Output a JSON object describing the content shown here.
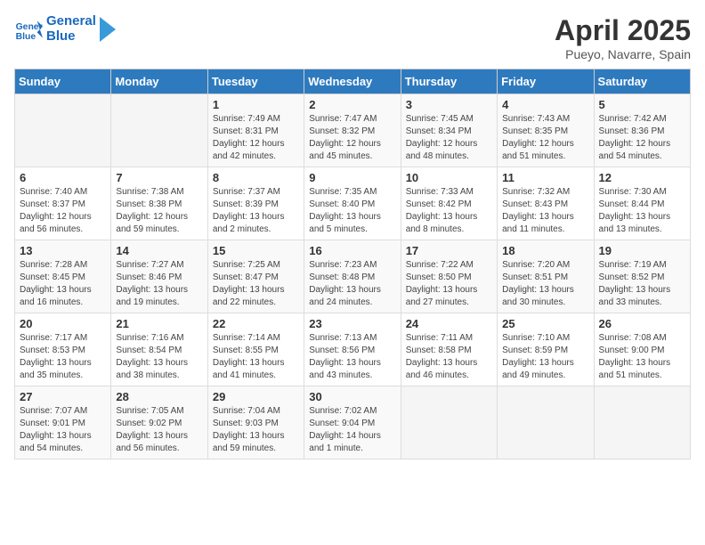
{
  "header": {
    "logo_line1": "General",
    "logo_line2": "Blue",
    "month_title": "April 2025",
    "location": "Pueyo, Navarre, Spain"
  },
  "weekdays": [
    "Sunday",
    "Monday",
    "Tuesday",
    "Wednesday",
    "Thursday",
    "Friday",
    "Saturday"
  ],
  "weeks": [
    [
      {
        "day": "",
        "info": ""
      },
      {
        "day": "",
        "info": ""
      },
      {
        "day": "1",
        "info": "Sunrise: 7:49 AM\nSunset: 8:31 PM\nDaylight: 12 hours and 42 minutes."
      },
      {
        "day": "2",
        "info": "Sunrise: 7:47 AM\nSunset: 8:32 PM\nDaylight: 12 hours and 45 minutes."
      },
      {
        "day": "3",
        "info": "Sunrise: 7:45 AM\nSunset: 8:34 PM\nDaylight: 12 hours and 48 minutes."
      },
      {
        "day": "4",
        "info": "Sunrise: 7:43 AM\nSunset: 8:35 PM\nDaylight: 12 hours and 51 minutes."
      },
      {
        "day": "5",
        "info": "Sunrise: 7:42 AM\nSunset: 8:36 PM\nDaylight: 12 hours and 54 minutes."
      }
    ],
    [
      {
        "day": "6",
        "info": "Sunrise: 7:40 AM\nSunset: 8:37 PM\nDaylight: 12 hours and 56 minutes."
      },
      {
        "day": "7",
        "info": "Sunrise: 7:38 AM\nSunset: 8:38 PM\nDaylight: 12 hours and 59 minutes."
      },
      {
        "day": "8",
        "info": "Sunrise: 7:37 AM\nSunset: 8:39 PM\nDaylight: 13 hours and 2 minutes."
      },
      {
        "day": "9",
        "info": "Sunrise: 7:35 AM\nSunset: 8:40 PM\nDaylight: 13 hours and 5 minutes."
      },
      {
        "day": "10",
        "info": "Sunrise: 7:33 AM\nSunset: 8:42 PM\nDaylight: 13 hours and 8 minutes."
      },
      {
        "day": "11",
        "info": "Sunrise: 7:32 AM\nSunset: 8:43 PM\nDaylight: 13 hours and 11 minutes."
      },
      {
        "day": "12",
        "info": "Sunrise: 7:30 AM\nSunset: 8:44 PM\nDaylight: 13 hours and 13 minutes."
      }
    ],
    [
      {
        "day": "13",
        "info": "Sunrise: 7:28 AM\nSunset: 8:45 PM\nDaylight: 13 hours and 16 minutes."
      },
      {
        "day": "14",
        "info": "Sunrise: 7:27 AM\nSunset: 8:46 PM\nDaylight: 13 hours and 19 minutes."
      },
      {
        "day": "15",
        "info": "Sunrise: 7:25 AM\nSunset: 8:47 PM\nDaylight: 13 hours and 22 minutes."
      },
      {
        "day": "16",
        "info": "Sunrise: 7:23 AM\nSunset: 8:48 PM\nDaylight: 13 hours and 24 minutes."
      },
      {
        "day": "17",
        "info": "Sunrise: 7:22 AM\nSunset: 8:50 PM\nDaylight: 13 hours and 27 minutes."
      },
      {
        "day": "18",
        "info": "Sunrise: 7:20 AM\nSunset: 8:51 PM\nDaylight: 13 hours and 30 minutes."
      },
      {
        "day": "19",
        "info": "Sunrise: 7:19 AM\nSunset: 8:52 PM\nDaylight: 13 hours and 33 minutes."
      }
    ],
    [
      {
        "day": "20",
        "info": "Sunrise: 7:17 AM\nSunset: 8:53 PM\nDaylight: 13 hours and 35 minutes."
      },
      {
        "day": "21",
        "info": "Sunrise: 7:16 AM\nSunset: 8:54 PM\nDaylight: 13 hours and 38 minutes."
      },
      {
        "day": "22",
        "info": "Sunrise: 7:14 AM\nSunset: 8:55 PM\nDaylight: 13 hours and 41 minutes."
      },
      {
        "day": "23",
        "info": "Sunrise: 7:13 AM\nSunset: 8:56 PM\nDaylight: 13 hours and 43 minutes."
      },
      {
        "day": "24",
        "info": "Sunrise: 7:11 AM\nSunset: 8:58 PM\nDaylight: 13 hours and 46 minutes."
      },
      {
        "day": "25",
        "info": "Sunrise: 7:10 AM\nSunset: 8:59 PM\nDaylight: 13 hours and 49 minutes."
      },
      {
        "day": "26",
        "info": "Sunrise: 7:08 AM\nSunset: 9:00 PM\nDaylight: 13 hours and 51 minutes."
      }
    ],
    [
      {
        "day": "27",
        "info": "Sunrise: 7:07 AM\nSunset: 9:01 PM\nDaylight: 13 hours and 54 minutes."
      },
      {
        "day": "28",
        "info": "Sunrise: 7:05 AM\nSunset: 9:02 PM\nDaylight: 13 hours and 56 minutes."
      },
      {
        "day": "29",
        "info": "Sunrise: 7:04 AM\nSunset: 9:03 PM\nDaylight: 13 hours and 59 minutes."
      },
      {
        "day": "30",
        "info": "Sunrise: 7:02 AM\nSunset: 9:04 PM\nDaylight: 14 hours and 1 minute."
      },
      {
        "day": "",
        "info": ""
      },
      {
        "day": "",
        "info": ""
      },
      {
        "day": "",
        "info": ""
      }
    ]
  ]
}
